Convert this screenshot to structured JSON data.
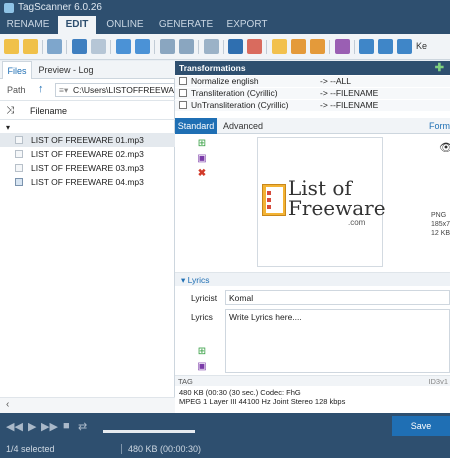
{
  "window": {
    "title": "TagScanner 6.0.26"
  },
  "menu": {
    "tabs": [
      "RENAME",
      "EDIT",
      "ONLINE",
      "GENERATE",
      "EXPORT"
    ],
    "active": "EDIT"
  },
  "left": {
    "tabs": [
      "Files",
      "Preview - Log"
    ],
    "path_label": "Path",
    "path_value": "C:\\Users\\LISTOFFREEWARE",
    "column_header": "Filename",
    "files": [
      "LIST OF FREEWARE 01.mp3",
      "LIST OF FREEWARE 02.mp3",
      "LIST OF FREEWARE 03.mp3",
      "LIST OF FREEWARE 04.mp3"
    ]
  },
  "transformations": {
    "header": "Transformations",
    "rows": [
      {
        "name": "Normalize english",
        "arrow": "->",
        "target": "--ALL"
      },
      {
        "name": "Transliteration (Cyrillic)",
        "arrow": "->",
        "target": "--FILENAME"
      },
      {
        "name": "UnTransliteration (Cyrillic)",
        "arrow": "->",
        "target": "--FILENAME"
      }
    ]
  },
  "editor": {
    "tabs": [
      "Standard",
      "Advanced"
    ],
    "format_link": "Form",
    "cover_text": {
      "line1": "List of",
      "line2": "Freeware",
      "line3": ".com"
    },
    "image_info": [
      "PNG",
      "185x7",
      "12 KB"
    ],
    "lyrics_section": "Lyrics",
    "lyricist_label": "Lyricist",
    "lyricist_value": "Komal",
    "lyrics_label": "Lyrics",
    "lyrics_value": "Write Lyrics here....",
    "tag_label": "TAG",
    "tag_version": "ID3v1",
    "info_line1": "480 KB (00:30 (30 sec.) Codec: FhG",
    "info_line2": "MPEG 1 Layer III  44100 Hz  Joint Stereo  128 kbps"
  },
  "save_label": "Save",
  "status": {
    "selected": "1/4 selected",
    "size": "480 KB (00:00:30)"
  },
  "colors": {
    "accent": "#1f6fb4",
    "dark": "#2e4f6f",
    "delete": "#d23a2a",
    "add": "#2e9b3b"
  }
}
